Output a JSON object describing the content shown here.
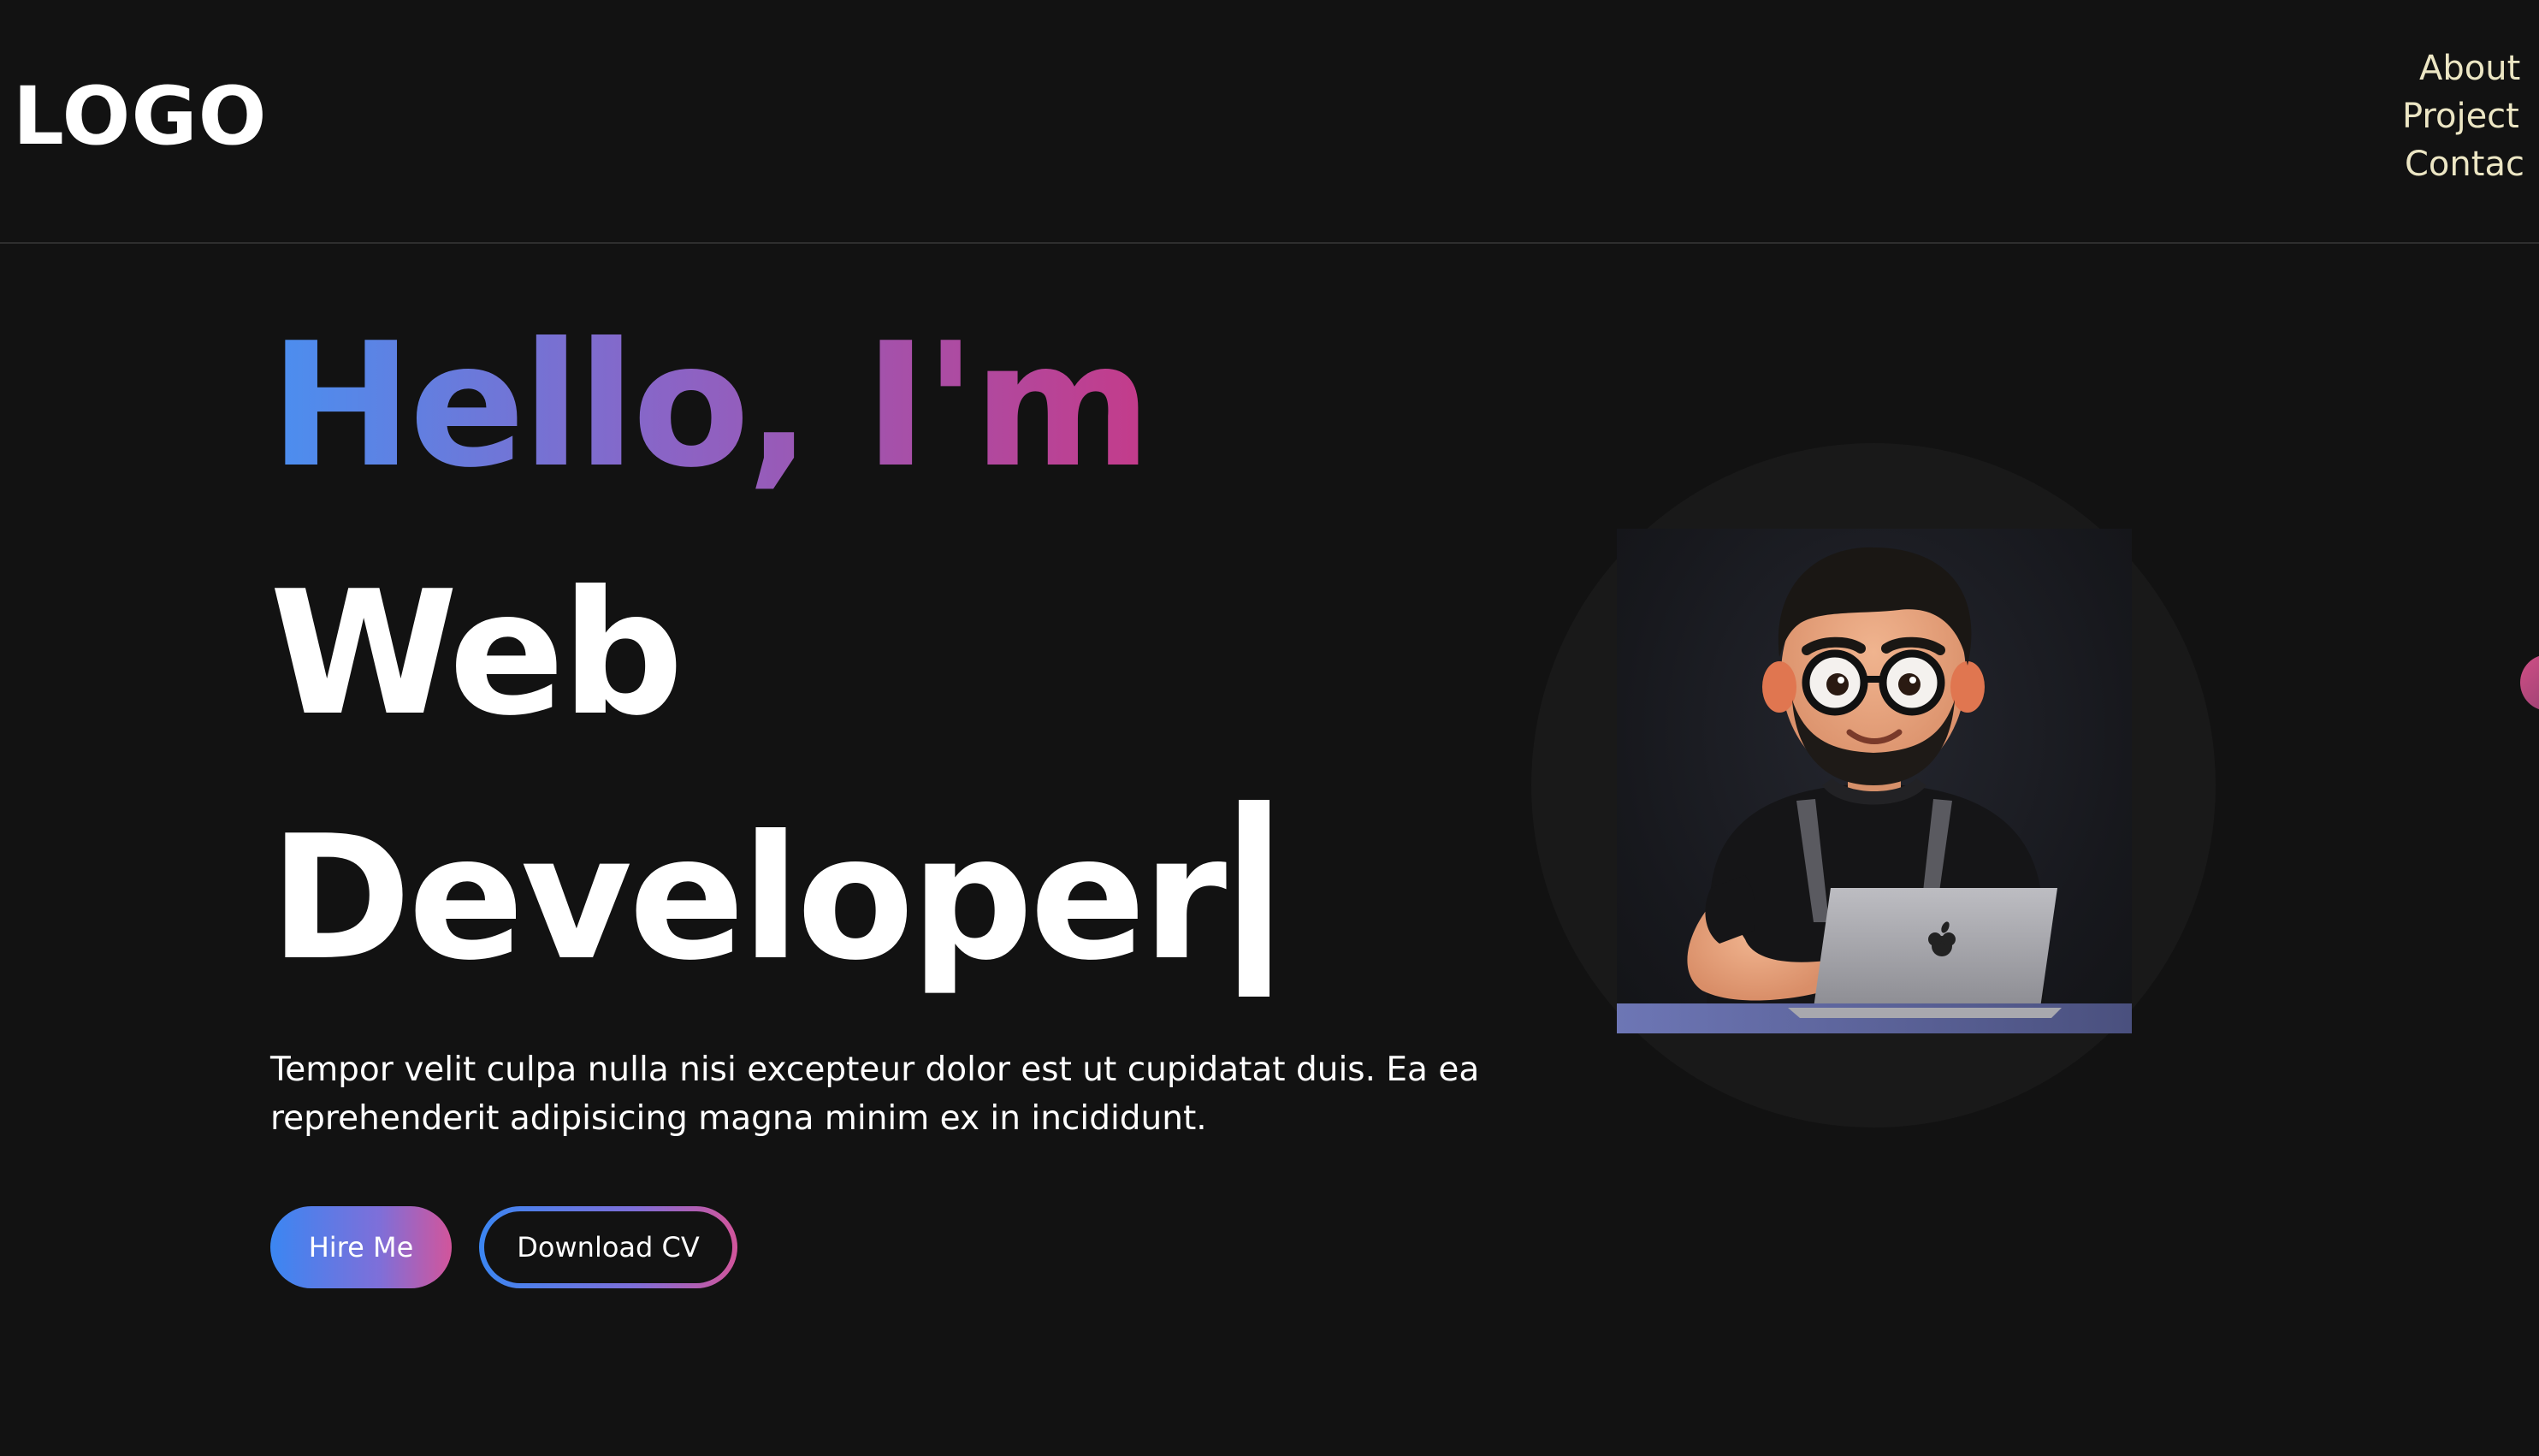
{
  "header": {
    "logo": "LOGO",
    "nav": [
      {
        "label": "About"
      },
      {
        "label": "Project"
      },
      {
        "label": "Contac"
      }
    ]
  },
  "hero": {
    "greeting": "Hello, I'm",
    "role_line_1": "Web",
    "role_line_2": "Developer",
    "intro_line_1": "Tempor velit culpa nulla nisi excepteur dolor est ut cupidatat duis. Ea ea",
    "intro_line_2": "reprehenderit adipisicing magna minim ex in incididunt.",
    "hire_label": "Hire Me",
    "cv_label": "Download CV"
  },
  "colors": {
    "background": "#121212",
    "accent_blue": "#3b86f2",
    "accent_pink": "#d2559b",
    "nav_text": "#ece6c4"
  },
  "icons": {
    "avatar": "developer-avatar-illustration",
    "laptop_logo": "apple-logo-icon"
  }
}
